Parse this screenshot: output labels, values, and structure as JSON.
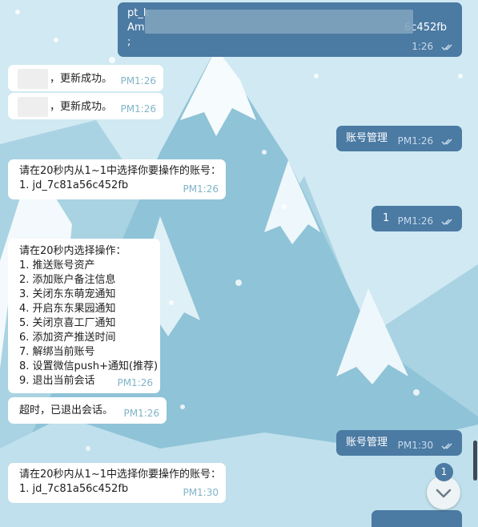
{
  "colors": {
    "incoming_bg": "#ffffff",
    "outgoing_bg": "#4b7aa3",
    "badge": "#4b7aa3"
  },
  "messages": [
    {
      "lines": [
        "pt_k",
        "Am",
        ";"
      ],
      "tail": "6c452fb",
      "time": "1:26"
    },
    {
      "lines": [
        "，更新成功。"
      ],
      "time": "PM1:26"
    },
    {
      "lines": [
        "，更新成功。"
      ],
      "time": "PM1:26"
    },
    {
      "lines": [
        "账号管理"
      ],
      "time": "PM1:26"
    },
    {
      "lines": [
        "请在20秒内从1~1中选择你要操作的账号：",
        "1. jd_7c81a56c452fb"
      ],
      "time": "PM1:26"
    },
    {
      "lines": [
        "1"
      ],
      "time": "PM1:26"
    },
    {
      "lines": [
        "请在20秒内选择操作：",
        "1. 推送账号资产",
        "2. 添加账户备注信息",
        "3. 关闭东东萌宠通知",
        "4. 开启东东果园通知",
        "5. 关闭京喜工厂通知",
        "6. 添加资产推送时间",
        "7. 解绑当前账号",
        "8. 设置微信push+通知(推荐)",
        "9. 退出当前会话"
      ],
      "time": "PM1:26"
    },
    {
      "lines": [
        "超时，已退出会话。"
      ],
      "time": "PM1:26"
    },
    {
      "lines": [
        "账号管理"
      ],
      "time": "PM1:30"
    },
    {
      "lines": [
        "请在20秒内从1~1中选择你要操作的账号：",
        "1. jd_7c81a56c452fb"
      ],
      "time": "PM1:30"
    }
  ],
  "unread_badge": "1",
  "icons": {
    "read_receipt": "double-check-icon",
    "scroll_down": "chevron-down-icon"
  }
}
